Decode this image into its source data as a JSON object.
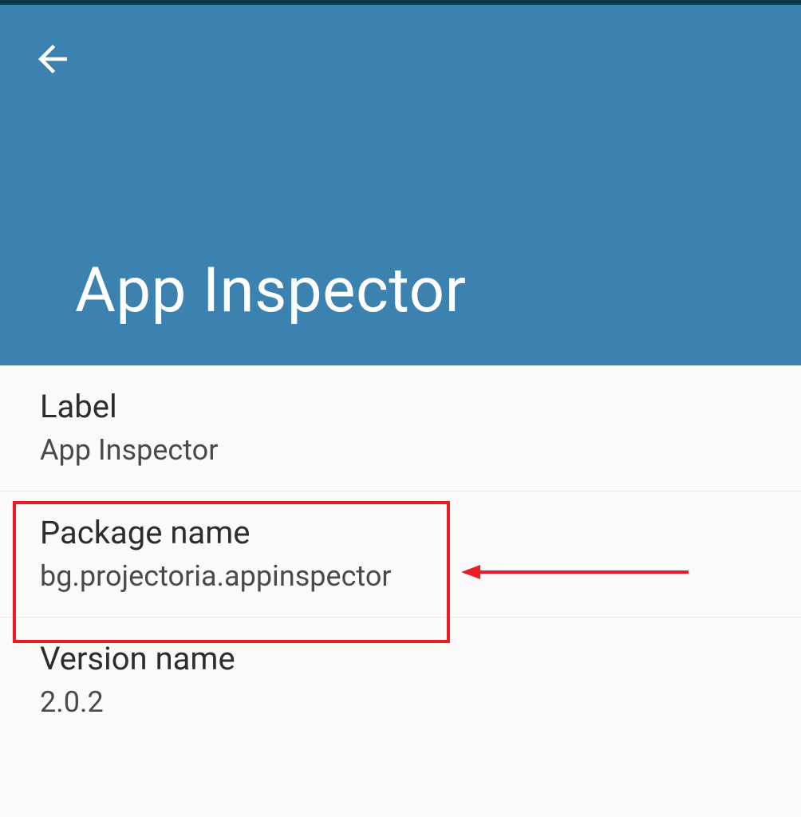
{
  "header": {
    "title": "App Inspector"
  },
  "rows": {
    "label": {
      "title": "Label",
      "value": "App Inspector"
    },
    "package": {
      "title": "Package name",
      "value": "bg.projectoria.appinspector"
    },
    "version": {
      "title": "Version name",
      "value": "2.0.2"
    }
  }
}
